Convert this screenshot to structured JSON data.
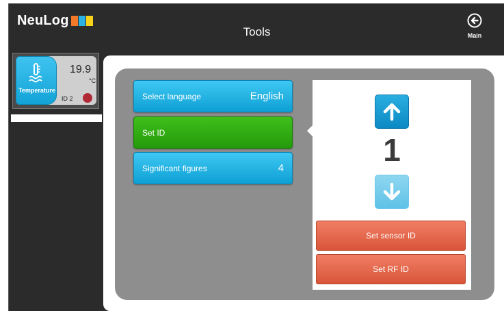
{
  "header": {
    "logo_text": "NeuLog",
    "title": "Tools",
    "main_label": "Main"
  },
  "sensor": {
    "name": "Temperature",
    "value": "19.9",
    "unit": "°C",
    "id": "ID 2"
  },
  "menu": {
    "items": [
      {
        "label": "Select language",
        "value": "English",
        "state": "normal"
      },
      {
        "label": "Set ID",
        "value": "",
        "state": "selected"
      },
      {
        "label": "Significant figures",
        "value": "4",
        "state": "normal"
      }
    ]
  },
  "set_id": {
    "current_id": "1",
    "set_sensor_id_label": "Set sensor ID",
    "set_rf_id_label": "Set RF ID"
  },
  "icons": {
    "main": "circle-arrow-left-icon",
    "sensor": "thermometer-icon",
    "up": "arrow-up-icon",
    "down": "arrow-down-icon"
  },
  "colors": {
    "blue_button": "#12a3d6",
    "green_selected": "#2fab12",
    "orange_action": "#e2654a",
    "logo_blocks": [
      "#f47a2a",
      "#2bb3e6",
      "#f7d21a"
    ],
    "header_bg": "#2b2b2b"
  }
}
